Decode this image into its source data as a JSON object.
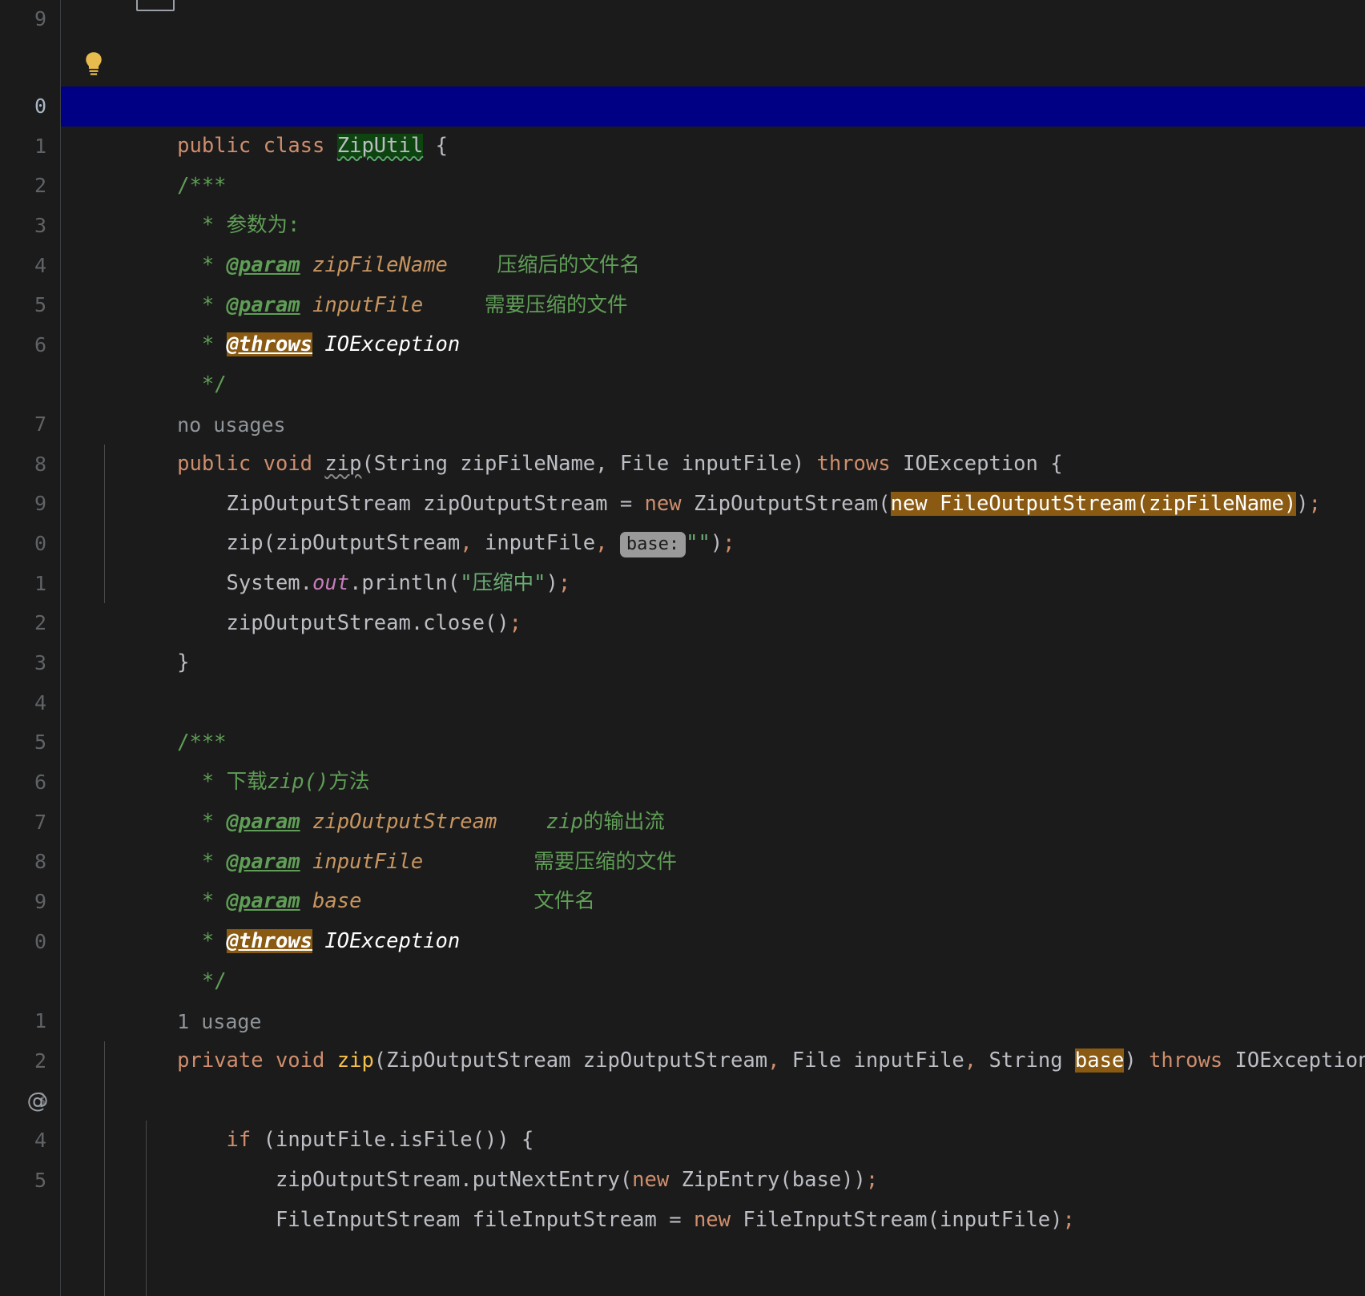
{
  "editor": {
    "language": "java",
    "theme": "darcula-dark",
    "background": "#1b1b1b",
    "selection_color": "#000084",
    "search_highlight_color": "#0d4410",
    "usage_highlight_color": "#8a5a12",
    "gutter_separator_color": "#3c3f41"
  },
  "gutter": {
    "at_marker": "@",
    "line_numbers": [
      "9",
      "0",
      "1",
      "2",
      "3",
      "4",
      "5",
      "6",
      "7",
      "8",
      "9",
      "0",
      "1",
      "2",
      "3",
      "4",
      "5",
      "6",
      "7",
      "8",
      "9",
      "0",
      "1",
      "2",
      "3",
      "4",
      "5"
    ]
  },
  "hints": {
    "no_usages_top": "no usages",
    "no_usages_method": "no usages",
    "one_usage": "1 usage",
    "base_param_hint": "base:"
  },
  "icons": {
    "lightbulb": "lightbulb-icon",
    "override_marker": "at-annotation-icon"
  },
  "lines": [
    {
      "n": "9",
      "text": ""
    },
    {
      "n": "0",
      "text": "public class ZipUtil {"
    },
    {
      "n": "1",
      "text": "    /***"
    },
    {
      "n": "2",
      "text": "     * 参数为:"
    },
    {
      "n": "3",
      "text": "     * @param zipFileName    压缩后的文件名"
    },
    {
      "n": "4",
      "text": "     * @param inputFile     需要压缩的文件"
    },
    {
      "n": "5",
      "text": "     * @throws IOException"
    },
    {
      "n": "6",
      "text": "     */"
    },
    {
      "n": "7",
      "text": "    public void zip(String zipFileName, File inputFile) throws IOException {"
    },
    {
      "n": "8",
      "text": "        ZipOutputStream zipOutputStream = new ZipOutputStream(new FileOutputStream(zipFileName));"
    },
    {
      "n": "9",
      "text": "        zip(zipOutputStream, inputFile, \"\");"
    },
    {
      "n": "0",
      "text": "        System.out.println(\"压缩中\");"
    },
    {
      "n": "1",
      "text": "        zipOutputStream.close();"
    },
    {
      "n": "2",
      "text": "    }"
    },
    {
      "n": "3",
      "text": ""
    },
    {
      "n": "4",
      "text": "    /***"
    },
    {
      "n": "5",
      "text": "     * 下载zip()方法"
    },
    {
      "n": "6",
      "text": "     * @param zipOutputStream    zip的输出流"
    },
    {
      "n": "7",
      "text": "     * @param inputFile         需要压缩的文件"
    },
    {
      "n": "8",
      "text": "     * @param base              文件名"
    },
    {
      "n": "9",
      "text": "     * @throws IOException"
    },
    {
      "n": "0",
      "text": "     */"
    },
    {
      "n": "1",
      "text": "    private void zip(ZipOutputStream zipOutputStream, File inputFile, String base) throws IOException {"
    },
    {
      "n": "2",
      "text": ""
    },
    {
      "n": "3",
      "text": "        if (inputFile.isFile()) {"
    },
    {
      "n": "4",
      "text": "            zipOutputStream.putNextEntry(new ZipEntry(base));"
    },
    {
      "n": "5",
      "text": "            FileInputStream fileInputStream = new FileInputStream(inputFile);"
    }
  ],
  "code_tokens": {
    "class_decl": {
      "kw_public": "public",
      "kw_class": "class",
      "name": "ZipUtil",
      "brace": "{"
    },
    "javadoc1": {
      "open": "/***",
      "line_desc": "* 参数为:",
      "param1_tag": "@param",
      "param1_name": "zipFileName",
      "param1_desc": "压缩后的文件名",
      "param2_tag": "@param",
      "param2_name": "inputFile",
      "param2_desc": "需要压缩的文件",
      "throws_tag": "@throws",
      "throws_type": "IOException",
      "close": "*/"
    },
    "method1": {
      "modifier": "public",
      "return_type": "void",
      "name": "zip",
      "params": "(String zipFileName, File inputFile)",
      "throws_kw": "throws",
      "throws_type": "IOException",
      "brace": "{"
    },
    "body1": {
      "l1_a": "ZipOutputStream zipOutputStream = ",
      "l1_new": "new",
      "l1_b": " ZipOutputStream(",
      "l1_hl": "new FileOutputStream(zipFileName)",
      "l1_c": ")",
      "l1_semi": ";",
      "l2_a": "zip(zipOutputStream",
      "l2_comma1": ",",
      "l2_b": " inputFile",
      "l2_comma2": ",",
      "l2_hint": "base:",
      "l2_str": "\"\"",
      "l2_c": ")",
      "l2_semi": ";",
      "l3_a": "System.",
      "l3_out": "out",
      "l3_b": ".println(",
      "l3_str": "\"压缩中\"",
      "l3_c": ")",
      "l3_semi": ";",
      "l4_a": "zipOutputStream.close()",
      "l4_semi": ";",
      "l5_brace": "}"
    },
    "javadoc2": {
      "open": "/***",
      "line_desc_a": "* ",
      "line_desc_b": "下载",
      "line_desc_c": "zip()",
      "line_desc_d": "方法",
      "param1_tag": "@param",
      "param1_name": "zipOutputStream",
      "param1_desc_a": "zip",
      "param1_desc_b": "的输出流",
      "param2_tag": "@param",
      "param2_name": "inputFile",
      "param2_desc": "需要压缩的文件",
      "param3_tag": "@param",
      "param3_name": "base",
      "param3_desc": "文件名",
      "throws_tag": "@throws",
      "throws_type": "IOException",
      "close": "*/"
    },
    "method2": {
      "modifier": "private",
      "return_type": "void",
      "name": "zip",
      "params_a": "(ZipOutputStream zipOutputStream",
      "comma1": ",",
      "params_b": " File inputFile",
      "comma2": ",",
      "params_c": " String ",
      "params_hl": "base",
      "params_d": ")",
      "throws_kw": "throws",
      "throws_type": "IOException",
      "brace": "{"
    },
    "body2": {
      "if_kw": "if",
      "if_cond": " (inputFile.isFile()) {",
      "l1_a": "zipOutputStream.putNextEntry(",
      "l1_new": "new",
      "l1_b": " ZipEntry(base))",
      "l1_semi": ";",
      "l2_a": "FileInputStream fileInputStream = ",
      "l2_new": "new",
      "l2_b": " FileInputStream(inputFile)",
      "l2_semi": ";"
    }
  }
}
